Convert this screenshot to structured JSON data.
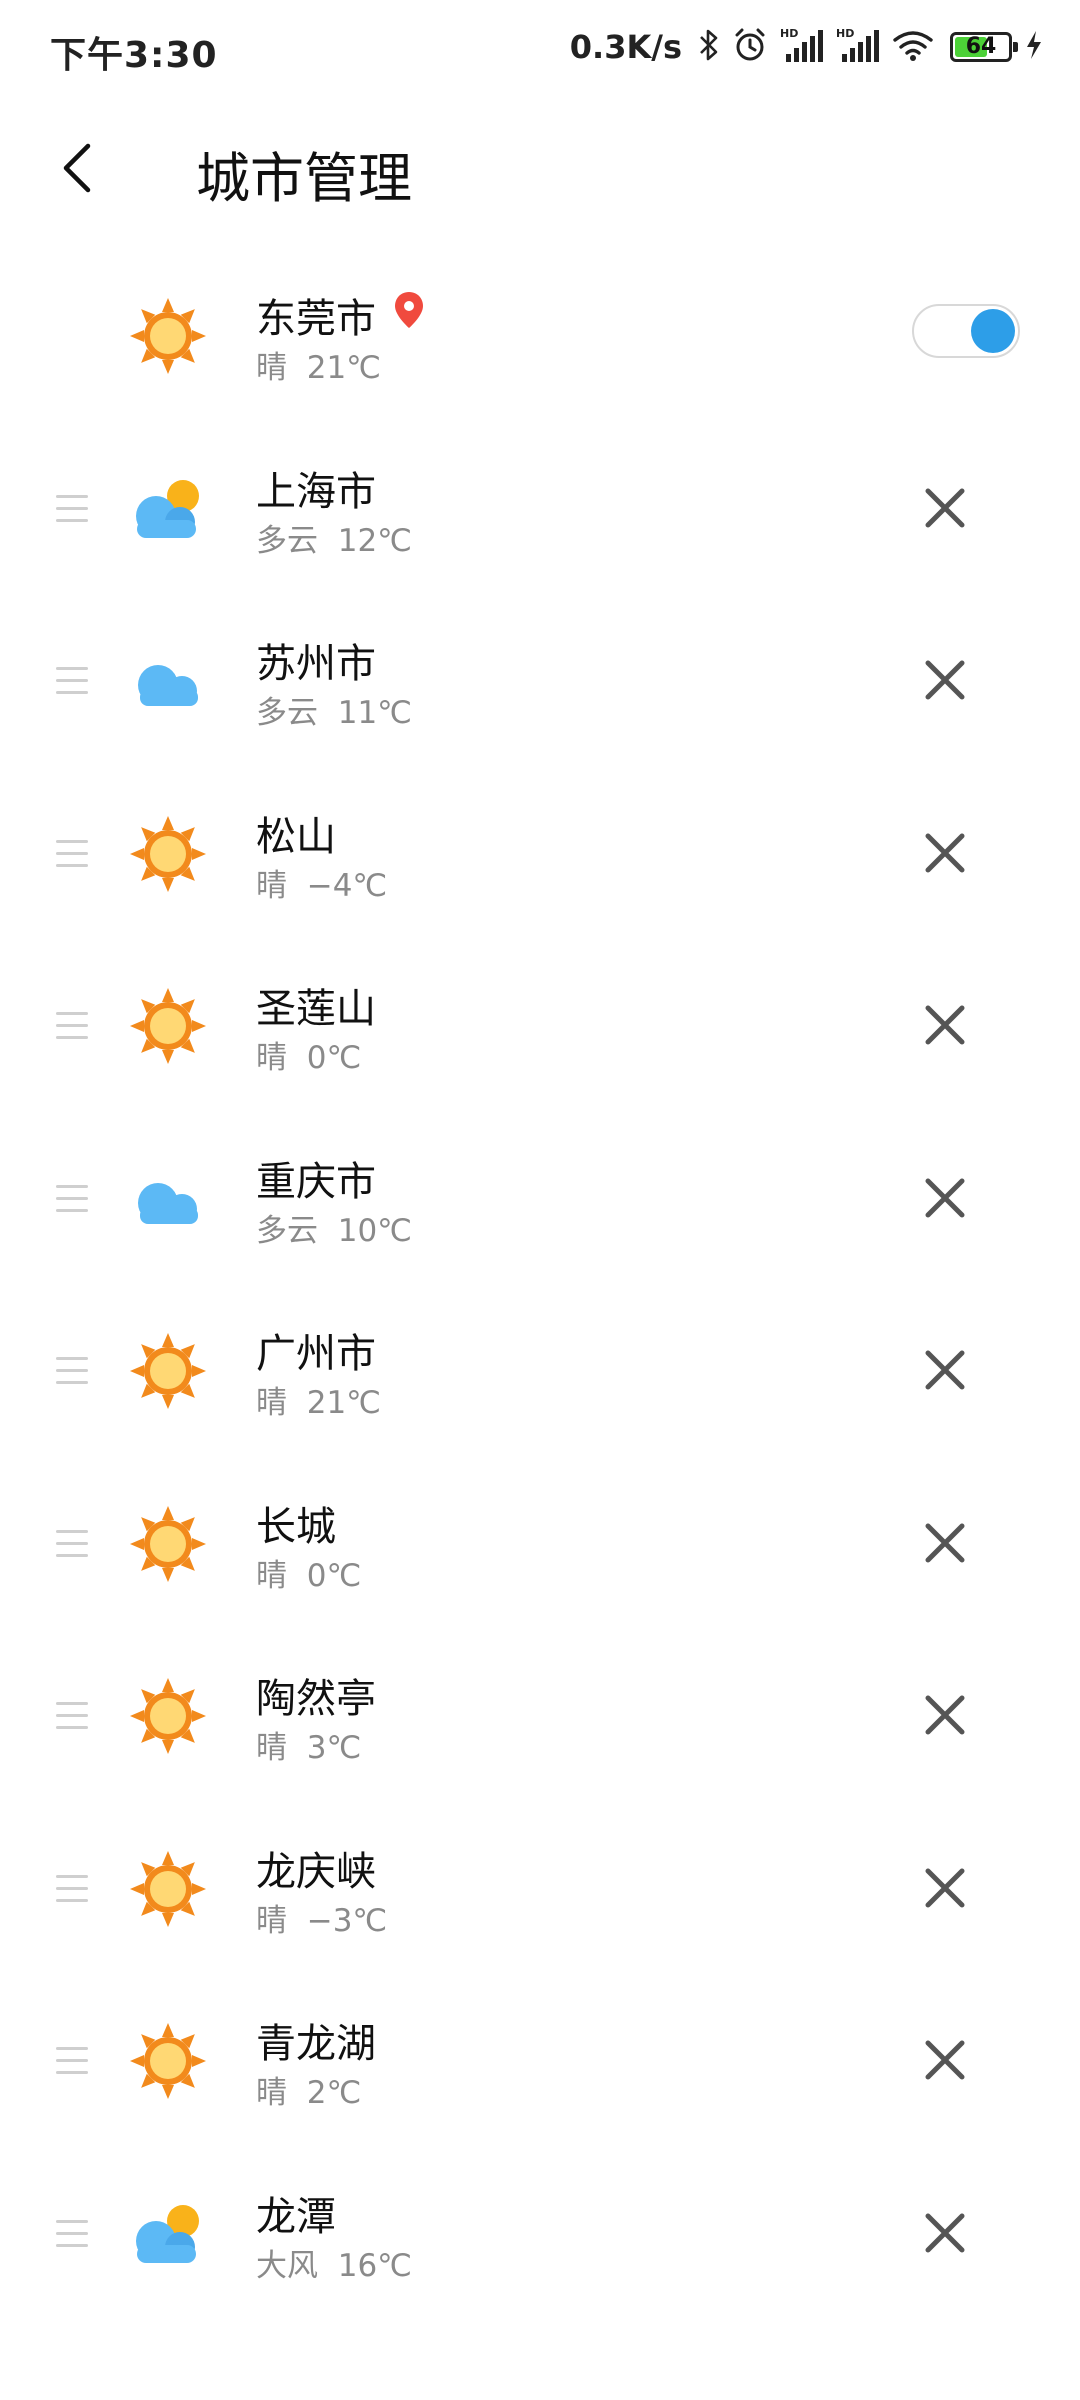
{
  "status_bar": {
    "time": "下午3:30",
    "net_speed": "0.3K/s",
    "battery_level": 64,
    "battery_text": "64",
    "icons": [
      "bluetooth-icon",
      "alarm-icon",
      "hd-signal-icon",
      "hd-signal-icon",
      "wifi-icon",
      "battery-icon",
      "charging-icon"
    ]
  },
  "header": {
    "title": "城市管理",
    "back_icon": "chevron-left-icon"
  },
  "cities": [
    {
      "name": "东莞市",
      "condition": "晴",
      "temp": "21℃",
      "icon": "sun",
      "location": true
    },
    {
      "name": "上海市",
      "condition": "多云",
      "temp": "12℃",
      "icon": "partly-cloudy"
    },
    {
      "name": "苏州市",
      "condition": "多云",
      "temp": "11℃",
      "icon": "cloud"
    },
    {
      "name": "松山",
      "condition": "晴",
      "temp": "−4℃",
      "icon": "sun"
    },
    {
      "name": "圣莲山",
      "condition": "晴",
      "temp": "0℃",
      "icon": "sun"
    },
    {
      "name": "重庆市",
      "condition": "多云",
      "temp": "10℃",
      "icon": "cloud"
    },
    {
      "name": "广州市",
      "condition": "晴",
      "temp": "21℃",
      "icon": "sun"
    },
    {
      "name": "长城",
      "condition": "晴",
      "temp": "0℃",
      "icon": "sun"
    },
    {
      "name": "陶然亭",
      "condition": "晴",
      "temp": "3℃",
      "icon": "sun"
    },
    {
      "name": "龙庆峡",
      "condition": "晴",
      "temp": "−3℃",
      "icon": "sun"
    },
    {
      "name": "青龙湖",
      "condition": "晴",
      "temp": "2℃",
      "icon": "sun"
    },
    {
      "name": "龙潭",
      "condition": "大风",
      "temp": "16℃",
      "icon": "partly-cloudy"
    }
  ],
  "colors": {
    "accent": "#2d9ee8",
    "sun_outer": "#f28a1c",
    "sun_inner": "#ffd874",
    "cloud": "#5cb9f5",
    "pin": "#f04a3e",
    "delete": "#555555"
  }
}
